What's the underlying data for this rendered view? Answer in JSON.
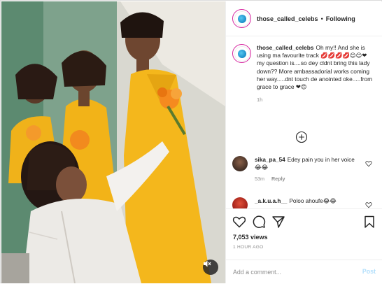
{
  "post": {
    "username": "those_called_celebs",
    "follow_separator": "•",
    "follow_label": "Following",
    "caption": "Oh my!! And she is using ma favourite track 💋💋💋💋😊😊❤ my question is....so dey cldnt bring this lady down?? More ambassadorial works coming her way.....dnt touch de anointed oke.....from grace to grace ❤😊",
    "caption_time": "1h",
    "views": "7,053 views",
    "posted_ago": "1 HOUR AGO",
    "add_comment_placeholder": "Add a comment...",
    "post_label": "Post"
  },
  "comments": [
    {
      "username": "sika_pa_54",
      "text": "Edey pain you in her voice 😂😂",
      "time": "53m",
      "reply_label": "Reply"
    },
    {
      "username": "_a.k.u.a.h__",
      "text": "Poloo ahoufe😂😂",
      "time": "",
      "reply_label": ""
    }
  ],
  "icons": {
    "like": "heart-icon",
    "comment": "comment-icon",
    "share": "share-icon",
    "save": "bookmark-icon",
    "load_more": "plus-circle-icon",
    "mute": "speaker-muted-icon"
  },
  "colors": {
    "text": "#262626",
    "muted": "#8e8e8e",
    "border": "#dbdbdb",
    "post_disabled": "#b2dffc",
    "story_ring": "#d6249f",
    "dress_yellow": "#f2b318"
  }
}
